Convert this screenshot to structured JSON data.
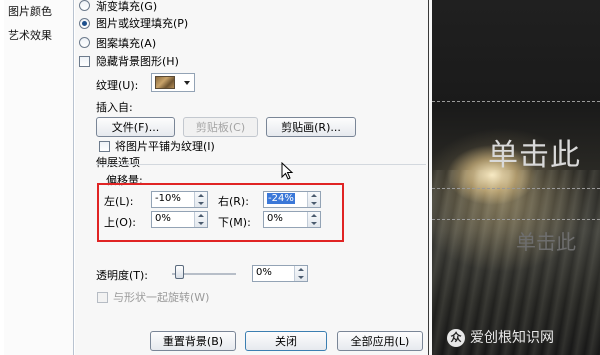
{
  "left_panel": {
    "items": [
      "图片颜色",
      "艺术效果"
    ]
  },
  "fill": {
    "options": [
      {
        "label": "渐变填充(G)",
        "selected": false
      },
      {
        "label": "图片或纹理填充(P)",
        "selected": true
      },
      {
        "label": "图案填充(A)",
        "selected": false
      }
    ],
    "hide_bg_label": "隐藏背景图形(H)",
    "texture_label": "纹理(U):",
    "insert_from_label": "插入自:",
    "file_button": "文件(F)...",
    "clipboard_button": "剪贴板(C)",
    "clipart_button": "剪贴画(R)...",
    "tile_label": "将图片平铺为纹理(I)",
    "stretch_label": "伸展选项",
    "offset_label": "偏移量:",
    "offsets": {
      "left_label": "左(L):",
      "left_value": "-10%",
      "right_label": "右(R):",
      "right_value": "-24%",
      "top_label": "上(O):",
      "top_value": "0%",
      "bottom_label": "下(M):",
      "bottom_value": "0%"
    },
    "transparency_label": "透明度(T):",
    "transparency_value": "0%",
    "transparency_level": 0,
    "rotate_label": "与形状一起旋转(W)"
  },
  "buttons": {
    "reset": "重置背景(B)",
    "close": "关闭",
    "apply_all": "全部应用(L)"
  },
  "slide": {
    "title": "单击此",
    "subtitle": "单击此"
  },
  "watermark": {
    "logo": "众",
    "text": "爱创根知识网"
  }
}
